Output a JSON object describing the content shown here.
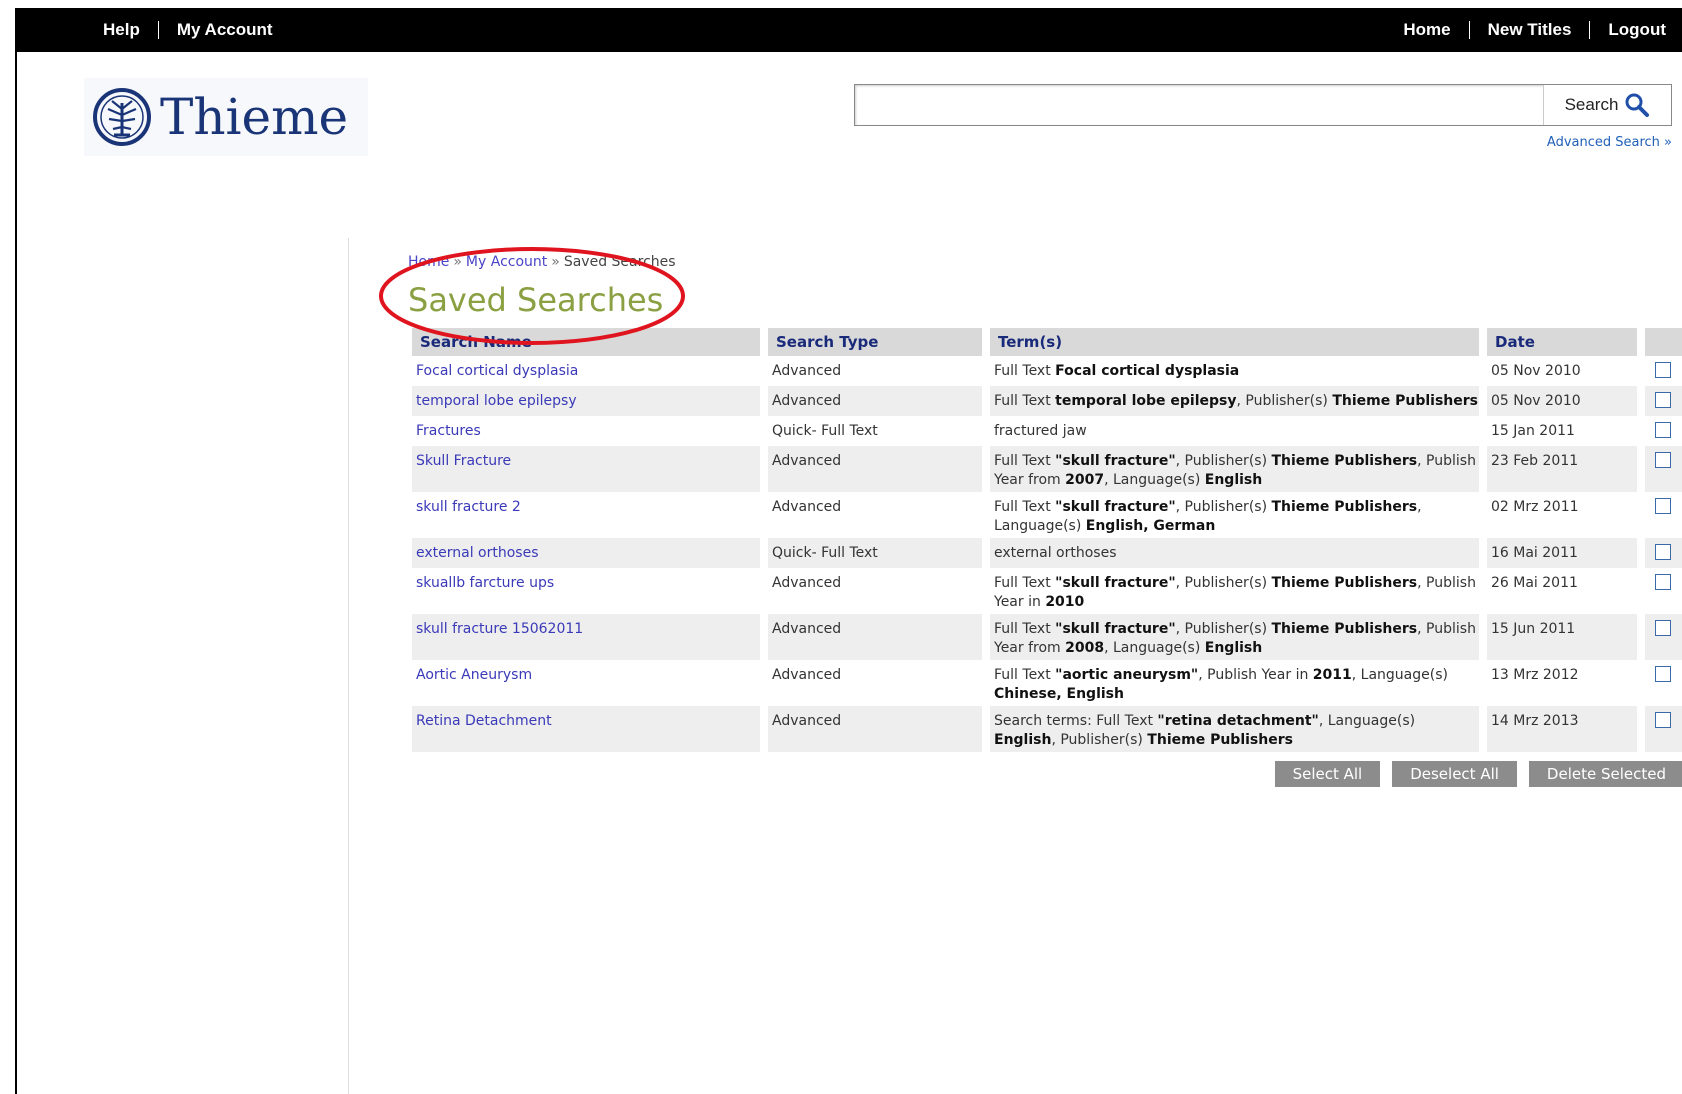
{
  "topbar": {
    "left_links": [
      "Help",
      "My Account"
    ],
    "right_links": [
      "Home",
      "New Titles",
      "Logout"
    ]
  },
  "logo": {
    "text": "Thieme",
    "emblem_icon": "thieme-tree-emblem-icon"
  },
  "search": {
    "value": "",
    "placeholder": "",
    "button_label": "Search",
    "button_icon": "magnifier-icon",
    "advanced_label": "Advanced Search »"
  },
  "breadcrumb": {
    "items": [
      "Home",
      "My Account",
      "Saved Searches"
    ],
    "separator": "»"
  },
  "page": {
    "title": "Saved Searches"
  },
  "table": {
    "headers": [
      "Search Name",
      "Search Type",
      "Term(s)",
      "Date",
      ""
    ],
    "rows": [
      {
        "name": "Focal cortical dysplasia",
        "type": "Advanced",
        "date": "05 Nov 2010",
        "terms": [
          [
            "",
            "Full Text "
          ],
          [
            "b",
            "Focal cortical dysplasia"
          ]
        ]
      },
      {
        "name": "temporal lobe epilepsy",
        "type": "Advanced",
        "date": "05 Nov 2010",
        "terms": [
          [
            "",
            "Full Text "
          ],
          [
            "b",
            "temporal lobe epilepsy"
          ],
          [
            "",
            ", Publisher(s) "
          ],
          [
            "b",
            "Thieme Publishers"
          ]
        ]
      },
      {
        "name": "Fractures",
        "type": "Quick- Full Text",
        "date": "15 Jan 2011",
        "terms": [
          [
            "",
            "fractured jaw"
          ]
        ]
      },
      {
        "name": "Skull Fracture",
        "type": "Advanced",
        "date": "23 Feb 2011",
        "terms": [
          [
            "",
            "Full Text "
          ],
          [
            "b",
            "\"skull fracture\""
          ],
          [
            "",
            ", Publisher(s) "
          ],
          [
            "b",
            "Thieme Publishers"
          ],
          [
            "",
            ", Publish Year from "
          ],
          [
            "b",
            "2007"
          ],
          [
            "",
            ", Language(s) "
          ],
          [
            "b",
            "English"
          ]
        ]
      },
      {
        "name": "skull fracture 2",
        "type": "Advanced",
        "date": "02 Mrz 2011",
        "terms": [
          [
            "",
            "Full Text "
          ],
          [
            "b",
            "\"skull fracture\""
          ],
          [
            "",
            ", Publisher(s) "
          ],
          [
            "b",
            "Thieme Publishers"
          ],
          [
            "",
            ", Language(s) "
          ],
          [
            "b",
            "English, German"
          ]
        ]
      },
      {
        "name": "external orthoses",
        "type": "Quick- Full Text",
        "date": "16 Mai 2011",
        "terms": [
          [
            "",
            "external orthoses"
          ]
        ]
      },
      {
        "name": "skuallb farcture ups",
        "type": "Advanced",
        "date": "26 Mai 2011",
        "terms": [
          [
            "",
            "Full Text "
          ],
          [
            "b",
            "\"skull fracture\""
          ],
          [
            "",
            ", Publisher(s) "
          ],
          [
            "b",
            "Thieme Publishers"
          ],
          [
            "",
            ", Publish Year in "
          ],
          [
            "b",
            "2010"
          ]
        ]
      },
      {
        "name": "skull fracture 15062011",
        "type": "Advanced",
        "date": "15 Jun 2011",
        "terms": [
          [
            "",
            "Full Text "
          ],
          [
            "b",
            "\"skull fracture\""
          ],
          [
            "",
            ", Publisher(s) "
          ],
          [
            "b",
            "Thieme Publishers"
          ],
          [
            "",
            ", Publish Year from "
          ],
          [
            "b",
            "2008"
          ],
          [
            "",
            ", Language(s) "
          ],
          [
            "b",
            "English"
          ]
        ]
      },
      {
        "name": "Aortic Aneurysm",
        "type": "Advanced",
        "date": "13 Mrz 2012",
        "terms": [
          [
            "",
            "Full Text "
          ],
          [
            "b",
            "\"aortic aneurysm\""
          ],
          [
            "",
            ", Publish Year in "
          ],
          [
            "b",
            "2011"
          ],
          [
            "",
            ", Language(s) "
          ],
          [
            "b",
            "Chinese, English"
          ]
        ]
      },
      {
        "name": "Retina Detachment",
        "type": "Advanced",
        "date": "14 Mrz 2013",
        "terms": [
          [
            "",
            "Search terms: Full Text "
          ],
          [
            "b",
            "\"retina detachment\""
          ],
          [
            "",
            ", Language(s) "
          ],
          [
            "b",
            "English"
          ],
          [
            "",
            ", Publisher(s) "
          ],
          [
            "b",
            "Thieme Publishers"
          ]
        ]
      }
    ]
  },
  "buttons": {
    "select_all": "Select All",
    "deselect_all": "Deselect All",
    "delete_selected": "Delete Selected"
  },
  "colors": {
    "topbar": "#000000",
    "title": "#8aa042",
    "link": "#3a39b8",
    "header_bg": "#d9d9d9",
    "annotation": "#e0141e",
    "logo": "#1a3577"
  }
}
